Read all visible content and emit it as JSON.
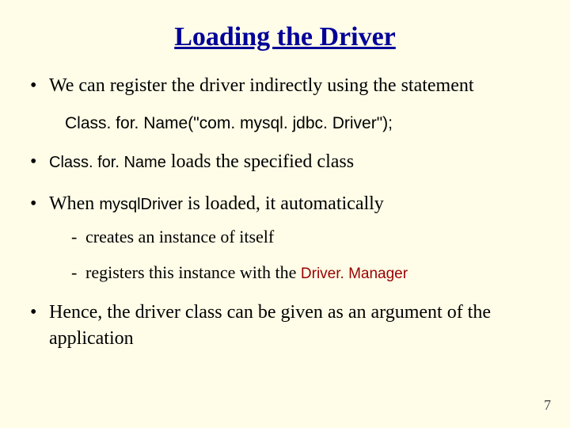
{
  "title": "Loading the Driver",
  "bullets": {
    "b1": "We can register the driver indirectly using the statement",
    "code_line": "Class. for. Name(\"com. mysql. jdbc. Driver\");",
    "b2_code": "Class. for. Name",
    "b2_rest": " loads the specified class",
    "b3_a": "When ",
    "b3_code": "mysqlDriver",
    "b3_b": " is loaded, it automatically",
    "b3_sub1": "creates an instance of itself",
    "b3_sub2_a": "registers this instance with the ",
    "b3_sub2_code": "Driver. Manager",
    "b4": "Hence, the driver class can be given as an argument of the application"
  },
  "page_number": "7"
}
